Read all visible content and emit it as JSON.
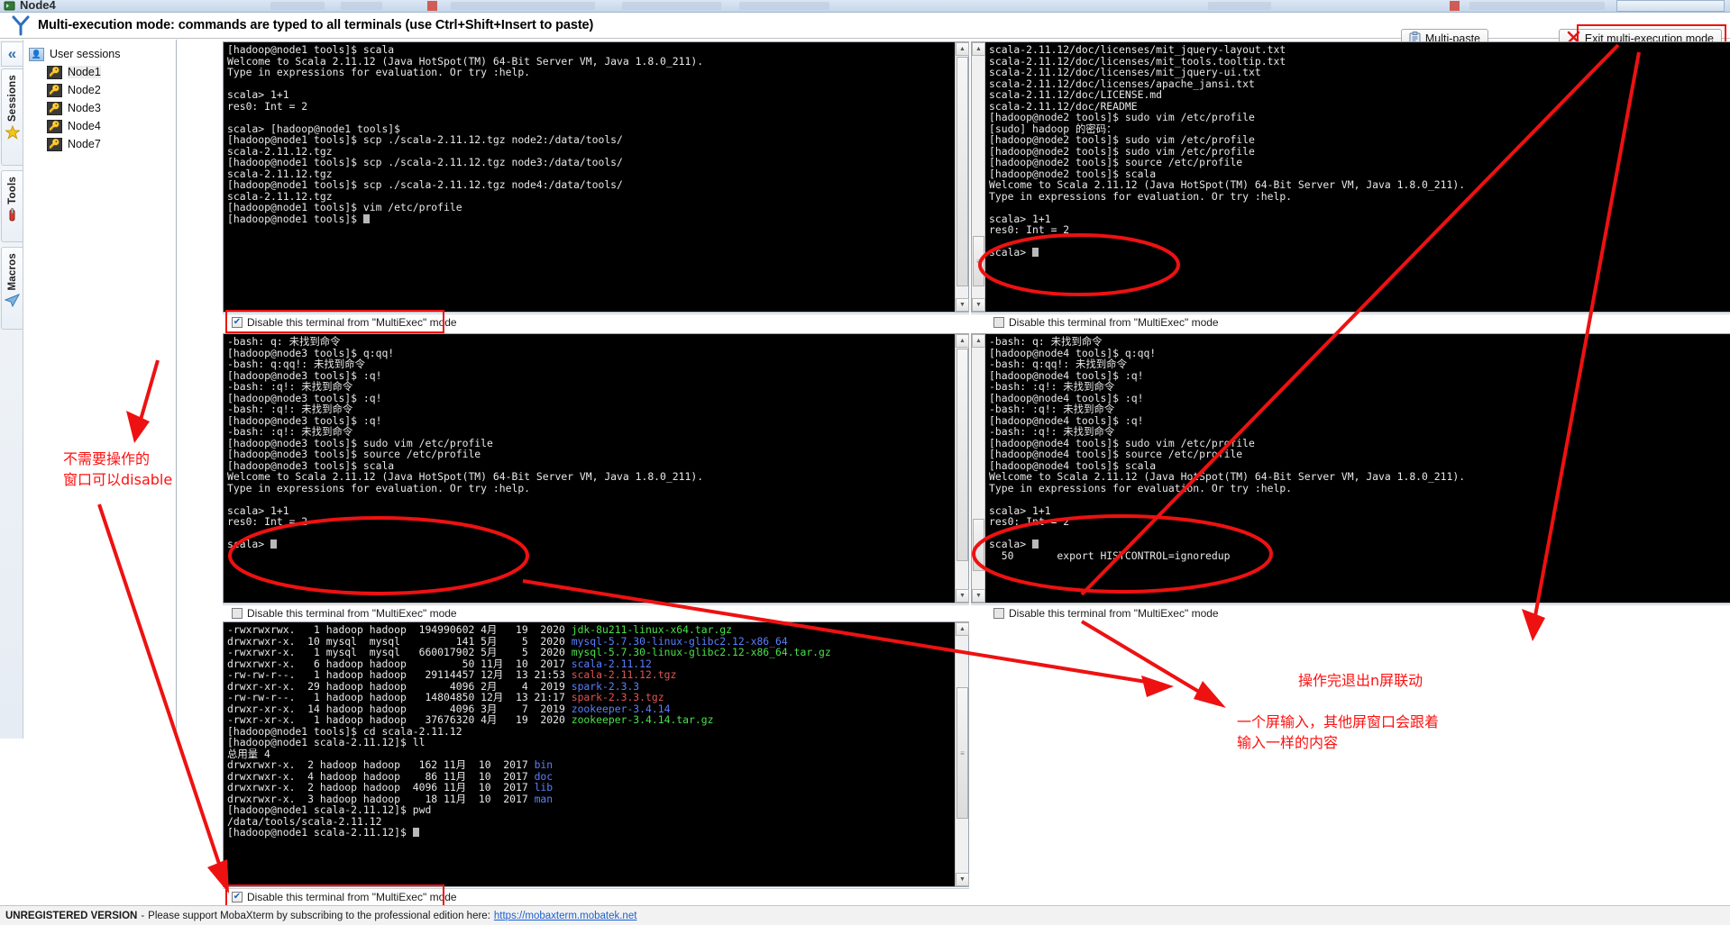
{
  "window": {
    "tab_title": "Node4",
    "tab_icon": "terminal-icon"
  },
  "header": {
    "title": "Multi-execution mode: commands are typed to all terminals (use Ctrl+Shift+Insert to paste)",
    "logo_icon": "mobaxterm-y-logo",
    "multi_paste_label": "Multi-paste",
    "multi_paste_icon": "clipboard-icon",
    "exit_label": "Exit multi-execution mode",
    "exit_icon": "red-x-icon"
  },
  "rail": {
    "collapse_icon": "double-chevron-left-icon",
    "groups": [
      {
        "label": "Sessions",
        "icon": "star-icon"
      },
      {
        "label": "Tools",
        "icon": "swiss-knife-icon"
      },
      {
        "label": "Macros",
        "icon": "paper-plane-icon"
      }
    ]
  },
  "sidebar": {
    "root_label": "User sessions",
    "root_icon": "user-icon",
    "items": [
      {
        "label": "Node1",
        "icon": "key-icon",
        "selected": true
      },
      {
        "label": "Node2",
        "icon": "key-icon",
        "selected": false
      },
      {
        "label": "Node3",
        "icon": "key-icon",
        "selected": false
      },
      {
        "label": "Node4",
        "icon": "key-icon",
        "selected": false
      },
      {
        "label": "Node7",
        "icon": "key-icon",
        "selected": false
      }
    ]
  },
  "checkbox_label": "Disable this terminal from \"MultiExec\" mode",
  "terminals": {
    "node1": {
      "name": "node1-terminal",
      "disabled_checked": true,
      "check_glyph": "✔",
      "lines": [
        "[hadoop@node1 tools]$ scala",
        "Welcome to Scala 2.11.12 (Java HotSpot(TM) 64-Bit Server VM, Java 1.8.0_211).",
        "Type in expressions for evaluation. Or try :help.",
        "",
        "scala> 1+1",
        "res0: Int = 2",
        "",
        "scala> [hadoop@node1 tools]$",
        "[hadoop@node1 tools]$ scp ./scala-2.11.12.tgz node2:/data/tools/",
        "scala-2.11.12.tgz",
        "[hadoop@node1 tools]$ scp ./scala-2.11.12.tgz node3:/data/tools/",
        "scala-2.11.12.tgz",
        "[hadoop@node1 tools]$ scp ./scala-2.11.12.tgz node4:/data/tools/",
        "scala-2.11.12.tgz",
        "[hadoop@node1 tools]$ vim /etc/profile",
        "[hadoop@node1 tools]$ █"
      ]
    },
    "node2": {
      "name": "node2-terminal",
      "disabled_checked": false,
      "lines": [
        "scala-2.11.12/doc/licenses/mit_jquery-layout.txt",
        "scala-2.11.12/doc/licenses/mit_tools.tooltip.txt",
        "scala-2.11.12/doc/licenses/mit_jquery-ui.txt",
        "scala-2.11.12/doc/licenses/apache_jansi.txt",
        "scala-2.11.12/doc/LICENSE.md",
        "scala-2.11.12/doc/README",
        "[hadoop@node2 tools]$ sudo vim /etc/profile",
        "[sudo] hadoop 的密码：",
        "[hadoop@node2 tools]$ sudo vim /etc/profile",
        "[hadoop@node2 tools]$ sudo vim /etc/profile",
        "[hadoop@node2 tools]$ source /etc/profile",
        "[hadoop@node2 tools]$ scala",
        "Welcome to Scala 2.11.12 (Java HotSpot(TM) 64-Bit Server VM, Java 1.8.0_211).",
        "Type in expressions for evaluation. Or try :help.",
        "",
        "scala> 1+1",
        "res0: Int = 2",
        "",
        "scala> █"
      ]
    },
    "node3": {
      "name": "node3-terminal",
      "disabled_checked": false,
      "lines": [
        "-bash: q: 未找到命令",
        "[hadoop@node3 tools]$ q:qq!",
        "-bash: q:qq!: 未找到命令",
        "[hadoop@node3 tools]$ :q!",
        "-bash: :q!: 未找到命令",
        "[hadoop@node3 tools]$ :q!",
        "-bash: :q!: 未找到命令",
        "[hadoop@node3 tools]$ :q!",
        "-bash: :q!: 未找到命令",
        "[hadoop@node3 tools]$ sudo vim /etc/profile",
        "[hadoop@node3 tools]$ source /etc/profile",
        "[hadoop@node3 tools]$ scala",
        "Welcome to Scala 2.11.12 (Java HotSpot(TM) 64-Bit Server VM, Java 1.8.0_211).",
        "Type in expressions for evaluation. Or try :help.",
        "",
        "scala> 1+1",
        "res0: Int = 2",
        "",
        "scala> █"
      ]
    },
    "node4": {
      "name": "node4-terminal",
      "disabled_checked": false,
      "lines": [
        "-bash: q: 未找到命令",
        "[hadoop@node4 tools]$ q:qq!",
        "-bash: q:qq!: 未找到命令",
        "[hadoop@node4 tools]$ :q!",
        "-bash: :q!: 未找到命令",
        "[hadoop@node4 tools]$ :q!",
        "-bash: :q!: 未找到命令",
        "[hadoop@node4 tools]$ :q!",
        "-bash: :q!: 未找到命令",
        "[hadoop@node4 tools]$ sudo vim /etc/profile",
        "[hadoop@node4 tools]$ source /etc/profile",
        "[hadoop@node4 tools]$ scala",
        "Welcome to Scala 2.11.12 (Java HotSpot(TM) 64-Bit Server VM, Java 1.8.0_211).",
        "Type in expressions for evaluation. Or try :help.",
        "",
        "scala> 1+1",
        "res0: Int = 2",
        "",
        "scala> █"
      ],
      "trailing_line": "  50       export HISTCONTROL=ignoredup"
    },
    "node1_bottom": {
      "name": "node1-bottom-terminal",
      "disabled_checked": true,
      "check_glyph": "✔",
      "listing": [
        {
          "perm": "-rwxrwxrwx.",
          "links": "1",
          "owner": "hadoop",
          "group": "hadoop",
          "size": "194990602",
          "month": "4月",
          "day": "19",
          "time": "2020",
          "file": "jdk-8u211-linux-x64.tar.gz",
          "color": "g"
        },
        {
          "perm": "drwxrwxr-x.",
          "links": "10",
          "owner": "mysql",
          "group": "mysql",
          "size": "141",
          "month": "5月",
          "day": "5",
          "time": "2020",
          "file": "mysql-5.7.30-linux-glibc2.12-x86_64",
          "color": "b"
        },
        {
          "perm": "-rwxrwxr-x.",
          "links": "1",
          "owner": "mysql",
          "group": "mysql",
          "size": "660017902",
          "month": "5月",
          "day": "5",
          "time": "2020",
          "file": "mysql-5.7.30-linux-glibc2.12-x86_64.tar.gz",
          "color": "g"
        },
        {
          "perm": "drwxrwxr-x.",
          "links": "6",
          "owner": "hadoop",
          "group": "hadoop",
          "size": "50",
          "month": "11月",
          "day": "10",
          "time": "2017",
          "file": "scala-2.11.12",
          "color": "b"
        },
        {
          "perm": "-rw-rw-r--.",
          "links": "1",
          "owner": "hadoop",
          "group": "hadoop",
          "size": "29114457",
          "month": "12月",
          "day": "13",
          "time": "21:53",
          "file": "scala-2.11.12.tgz",
          "color": "r"
        },
        {
          "perm": "drwxr-xr-x.",
          "links": "29",
          "owner": "hadoop",
          "group": "hadoop",
          "size": "4096",
          "month": "2月",
          "day": "4",
          "time": "2019",
          "file": "spark-2.3.3",
          "color": "b"
        },
        {
          "perm": "-rw-rw-r--.",
          "links": "1",
          "owner": "hadoop",
          "group": "hadoop",
          "size": "14804850",
          "month": "12月",
          "day": "13",
          "time": "21:17",
          "file": "spark-2.3.3.tgz",
          "color": "r"
        },
        {
          "perm": "drwxr-xr-x.",
          "links": "14",
          "owner": "hadoop",
          "group": "hadoop",
          "size": "4096",
          "month": "3月",
          "day": "7",
          "time": "2019",
          "file": "zookeeper-3.4.14",
          "color": "b"
        },
        {
          "perm": "-rwxr-xr-x.",
          "links": "1",
          "owner": "hadoop",
          "group": "hadoop",
          "size": "37676320",
          "month": "4月",
          "day": "19",
          "time": "2020",
          "file": "zookeeper-3.4.14.tar.gz",
          "color": "g"
        }
      ],
      "tail_lines": [
        "[hadoop@node1 tools]$ cd scala-2.11.12",
        "[hadoop@node1 scala-2.11.12]$ ll",
        "总用量 4"
      ],
      "listing2": [
        {
          "perm": "drwxrwxr-x.",
          "links": "2",
          "owner": "hadoop",
          "group": "hadoop",
          "size": "162",
          "month": "11月",
          "day": "10",
          "time": "2017",
          "file": "bin",
          "color": "b"
        },
        {
          "perm": "drwxrwxr-x.",
          "links": "4",
          "owner": "hadoop",
          "group": "hadoop",
          "size": "86",
          "month": "11月",
          "day": "10",
          "time": "2017",
          "file": "doc",
          "color": "b"
        },
        {
          "perm": "drwxrwxr-x.",
          "links": "2",
          "owner": "hadoop",
          "group": "hadoop",
          "size": "4096",
          "month": "11月",
          "day": "10",
          "time": "2017",
          "file": "lib",
          "color": "b"
        },
        {
          "perm": "drwxrwxr-x.",
          "links": "3",
          "owner": "hadoop",
          "group": "hadoop",
          "size": "18",
          "month": "11月",
          "day": "10",
          "time": "2017",
          "file": "man",
          "color": "b"
        }
      ],
      "tail_lines2": [
        "[hadoop@node1 scala-2.11.12]$ pwd",
        "/data/tools/scala-2.11.12",
        "[hadoop@node1 scala-2.11.12]$ █"
      ]
    }
  },
  "annotations": {
    "color": "#ff1010",
    "disable_note": "不需要操作的\n窗口可以disable",
    "exit_note": "操作完退出n屏联动",
    "sync_note": "一个屏输入，其他屏窗口会跟着\n输入一样的内容"
  },
  "statusbar": {
    "unregistered": "UNREGISTERED VERSION",
    "separator": "-",
    "message": "Please support MobaXterm by subscribing to the professional edition here:",
    "link": "https://mobaxterm.mobatek.net"
  }
}
